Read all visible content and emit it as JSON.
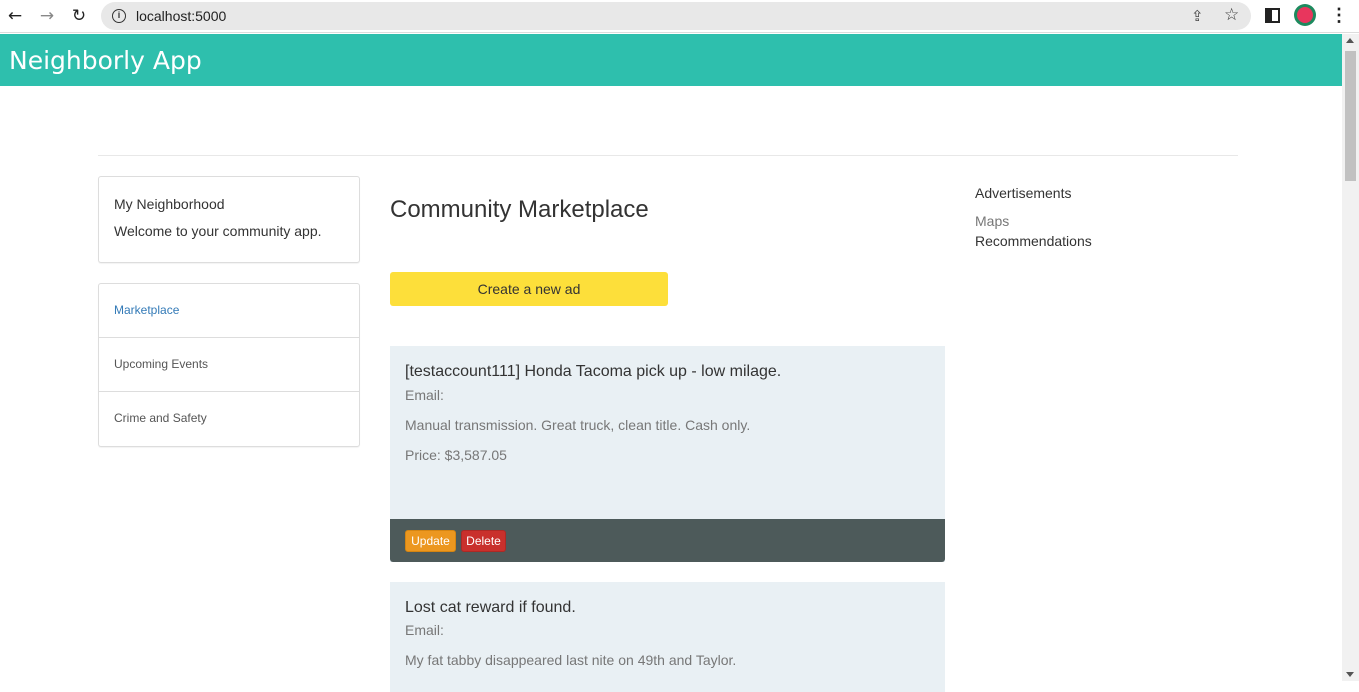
{
  "browser": {
    "url": "localhost:5000",
    "icons": {
      "back": "arrow-left",
      "forward": "arrow-right",
      "reload": "reload",
      "info": "info-circle",
      "share": "share",
      "star": "star",
      "side_panel": "side-panel",
      "profile": "profile",
      "menu": "kebab-menu"
    }
  },
  "header": {
    "title": "Neighborly App",
    "background": "#2ebfad"
  },
  "sidebar": {
    "intro_title": "My Neighborhood",
    "intro_text": "Welcome to your community app.",
    "nav": [
      {
        "label": "Marketplace",
        "active": true
      },
      {
        "label": "Upcoming Events",
        "active": false
      },
      {
        "label": "Crime and Safety",
        "active": false
      }
    ]
  },
  "main": {
    "heading": "Community Marketplace",
    "create_button": "Create a new ad",
    "ads": [
      {
        "title": "[testaccount111] Honda Tacoma pick up - low milage.",
        "email": "Email:",
        "description": "Manual transmission. Great truck, clean title. Cash only.",
        "price": "Price: $3,587.05",
        "update_label": "Update",
        "delete_label": "Delete"
      },
      {
        "title": "Lost cat reward if found.",
        "email": "Email:",
        "description": "My fat tabby disappeared last nite on 49th and Taylor."
      }
    ]
  },
  "right": {
    "heading": "Advertisements",
    "links": [
      "Maps",
      "Recommendations"
    ]
  },
  "colors": {
    "create_button": "#fddf3a",
    "update_button": "#ec971f",
    "delete_button": "#c9302c",
    "card_background": "#e9f0f4",
    "card_footer": "#4d5a5a",
    "active_link": "#337ab7"
  }
}
